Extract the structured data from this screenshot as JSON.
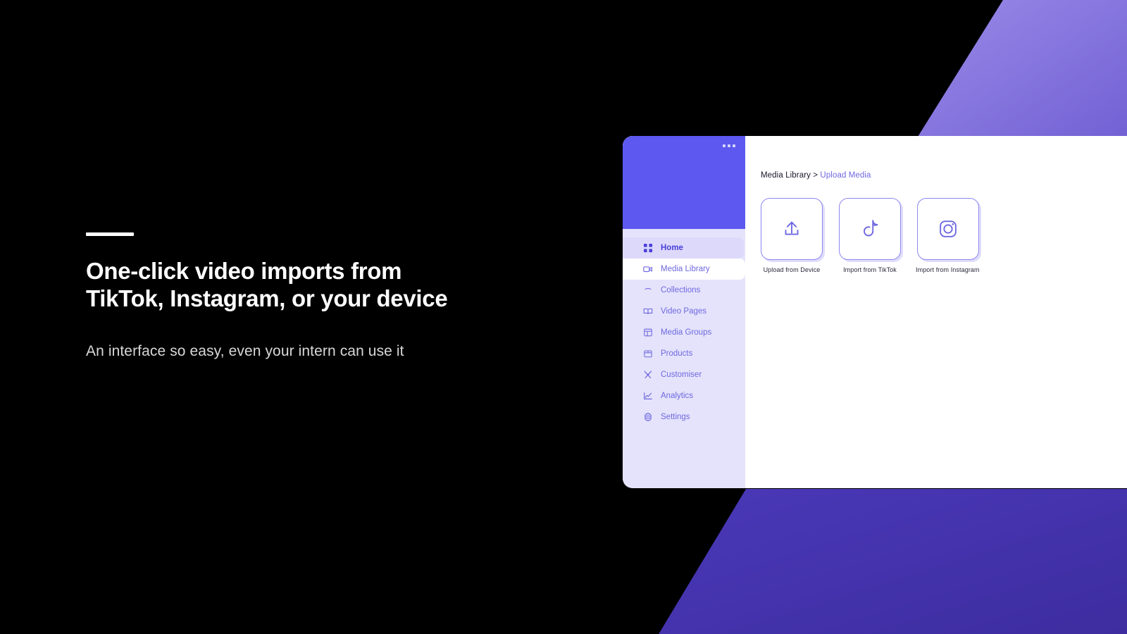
{
  "hero": {
    "title_line1": "One-click video imports from",
    "title_line2": "TikTok, Instagram, or your device",
    "subtitle": "An interface so easy, even your intern can use it"
  },
  "app": {
    "sidebar": {
      "menu_icon": "more-horizontal-icon",
      "items": [
        {
          "label": "Home",
          "icon": "grid-icon",
          "state": "active"
        },
        {
          "label": "Media Library",
          "icon": "video-icon",
          "state": "hover"
        },
        {
          "label": "Collections",
          "icon": "collections-icon",
          "state": "default"
        },
        {
          "label": "Video Pages",
          "icon": "book-icon",
          "state": "default"
        },
        {
          "label": "Media Groups",
          "icon": "layout-icon",
          "state": "default"
        },
        {
          "label": "Products",
          "icon": "box-icon",
          "state": "default"
        },
        {
          "label": "Customiser",
          "icon": "tools-icon",
          "state": "default"
        },
        {
          "label": "Analytics",
          "icon": "chart-icon",
          "state": "default"
        },
        {
          "label": "Settings",
          "icon": "gear-icon",
          "state": "default"
        }
      ]
    },
    "breadcrumb": {
      "parent": "Media Library",
      "separator": ">",
      "current": "Upload Media"
    },
    "cards": [
      {
        "label": "Upload from Device",
        "icon": "upload-icon"
      },
      {
        "label": "Import from TikTok",
        "icon": "tiktok-icon"
      },
      {
        "label": "Import from Instagram",
        "icon": "instagram-icon"
      }
    ]
  },
  "colors": {
    "background": "#000000",
    "accent_purple": "#5d58f0",
    "shape_light_purple": "#8b7fe0",
    "shape_dark_purple": "#4130ab",
    "sidebar_bg": "#e4e3fb",
    "nav_text": "#6f68e0",
    "card_border": "#8d86ef"
  }
}
